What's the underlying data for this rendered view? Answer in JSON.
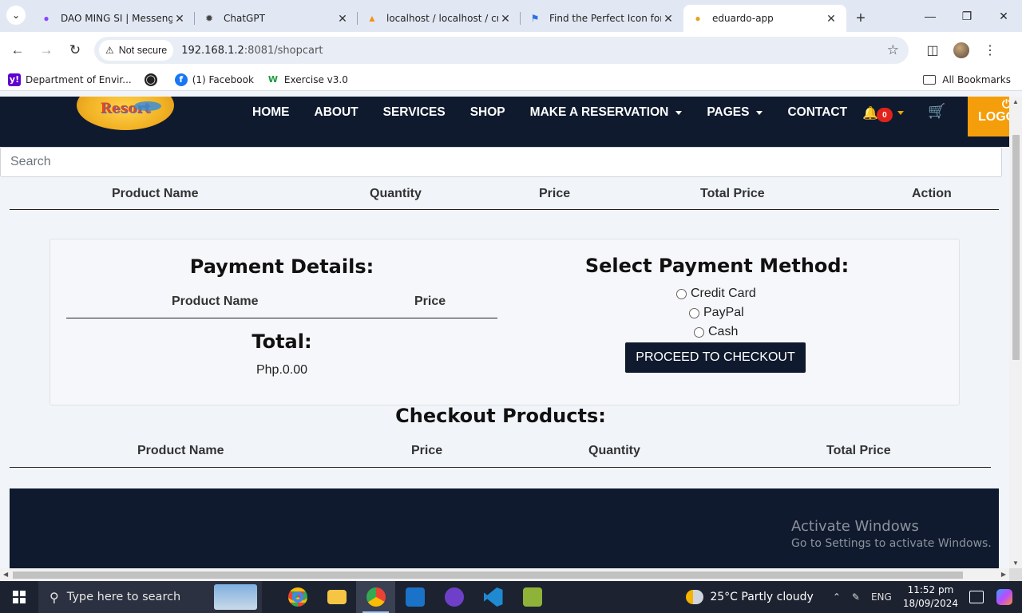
{
  "browser": {
    "tabs": [
      {
        "title": "DAO MING SI | Messenger",
        "icon": "messenger-icon",
        "active": false
      },
      {
        "title": "ChatGPT",
        "icon": "chatgpt-icon",
        "active": false
      },
      {
        "title": "localhost / localhost / crud",
        "icon": "phpmyadmin-icon",
        "active": false
      },
      {
        "title": "Find the Perfect Icon for Your",
        "icon": "flag-icon",
        "active": false
      },
      {
        "title": "eduardo-app",
        "icon": "app-icon",
        "active": true
      }
    ],
    "security_label": "Not secure",
    "url_host": "192.168.1.2",
    "url_path": ":8081/shopcart",
    "bookmarks": [
      {
        "label": "Department of Envir...",
        "icon": "yahoo-icon"
      },
      {
        "label": "",
        "icon": "globe-icon"
      },
      {
        "label": "(1) Facebook",
        "icon": "facebook-icon"
      },
      {
        "label": "Exercise v3.0",
        "icon": "w-icon"
      }
    ],
    "all_bookmarks": "All Bookmarks"
  },
  "site": {
    "logo_text": "Resort",
    "nav": [
      {
        "label": "HOME",
        "dropdown": false
      },
      {
        "label": "ABOUT",
        "dropdown": false
      },
      {
        "label": "SERVICES",
        "dropdown": false
      },
      {
        "label": "SHOP",
        "dropdown": false
      },
      {
        "label": "MAKE A RESERVATION",
        "dropdown": true
      },
      {
        "label": "PAGES",
        "dropdown": true
      },
      {
        "label": "CONTACT",
        "dropdown": false
      }
    ],
    "notification_count": "0",
    "logout_label": "LOGO"
  },
  "search": {
    "placeholder": "Search"
  },
  "cart_table": {
    "headers": [
      "Product Name",
      "Quantity",
      "Price",
      "Total Price",
      "Action"
    ]
  },
  "payment_details": {
    "title": "Payment Details:",
    "headers": [
      "Product Name",
      "Price"
    ],
    "total_label": "Total:",
    "total_value": "Php.0.00"
  },
  "payment_method": {
    "title": "Select Payment Method:",
    "options": [
      "Credit Card",
      "PayPal",
      "Cash"
    ],
    "button": "PROCEED TO CHECKOUT"
  },
  "checkout_products": {
    "title": "Checkout Products:",
    "headers": [
      "Product Name",
      "Price",
      "Quantity",
      "Total Price"
    ]
  },
  "watermark": {
    "line1": "Activate Windows",
    "line2": "Go to Settings to activate Windows."
  },
  "taskbar": {
    "search_placeholder": "Type here to search",
    "weather": "25°C  Partly cloudy",
    "language": "ENG",
    "time": "11:52 pm",
    "date": "18/09/2024",
    "apps": [
      "chrome",
      "file-explorer",
      "chrome-profile",
      "outlook",
      "github-desktop",
      "vscode",
      "xampp"
    ]
  }
}
